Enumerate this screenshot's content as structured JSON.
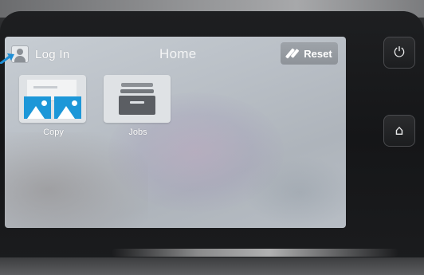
{
  "header": {
    "login_label": "Log In",
    "title": "Home",
    "reset_label": "Reset"
  },
  "apps": [
    {
      "label": "Copy",
      "icon": "copy-icon"
    },
    {
      "label": "Jobs",
      "icon": "jobs-icon"
    }
  ],
  "hardware_buttons": {
    "power": {
      "icon": "power-icon"
    },
    "home": {
      "icon": "home-icon"
    }
  },
  "colors": {
    "copy_icon_blue": "#1d97d8",
    "annotation_arrow": "#1f8fd6"
  }
}
